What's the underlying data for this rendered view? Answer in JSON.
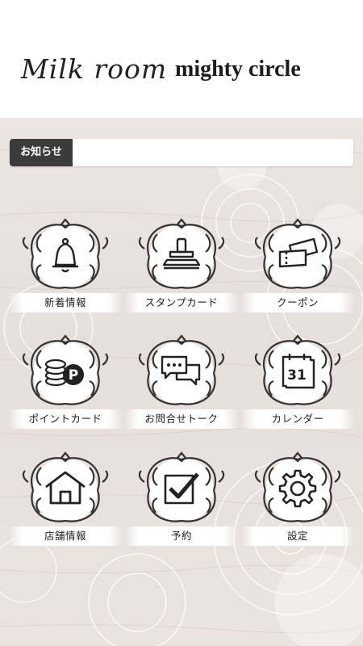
{
  "header": {
    "logo_left": "Milk room",
    "logo_right": "mighty circle"
  },
  "news": {
    "label": "お知らせ"
  },
  "menu": [
    {
      "label": "新着情報",
      "icon": "bell-icon"
    },
    {
      "label": "スタンプカード",
      "icon": "stamp-icon"
    },
    {
      "label": "クーポン",
      "icon": "coupon-icon"
    },
    {
      "label": "ポイントカード",
      "icon": "point-coins-icon"
    },
    {
      "label": "お問合せトーク",
      "icon": "chat-bubbles-icon"
    },
    {
      "label": "カレンダー",
      "icon": "calendar-icon"
    },
    {
      "label": "店舗情報",
      "icon": "house-icon"
    },
    {
      "label": "予約",
      "icon": "checkbox-icon"
    },
    {
      "label": "設定",
      "icon": "gear-icon"
    }
  ],
  "calendar_day": "31",
  "point_symbol": "P"
}
